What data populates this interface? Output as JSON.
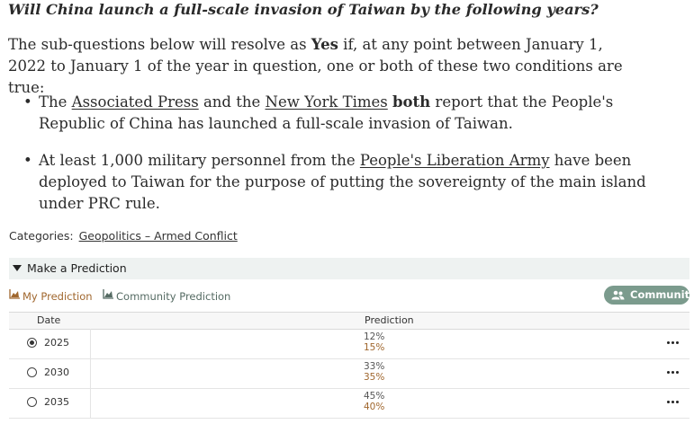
{
  "question": {
    "title": "Will China launch a full-scale invasion of Taiwan by the following years?",
    "intro_a": "The sub-questions below will resolve as ",
    "intro_yes": "Yes",
    "intro_b": " if, at any point between January 1, 2022 to January 1 of the year in question, one or both of these two conditions are true:"
  },
  "bullets": {
    "b1_pre": "The ",
    "b1_link1": "Associated Press",
    "b1_mid": " and the ",
    "b1_link2": "New York Times",
    "b1_bold": "both",
    "b1_post": " report that the People's Republic of China has launched a full-scale invasion of Taiwan.",
    "b2_pre": "At least 1,000 military personnel from the ",
    "b2_link": "People's Liberation Army",
    "b2_post": " have been deployed to Taiwan for the purpose of putting the sovereignty of the main island under PRC rule."
  },
  "categories": {
    "label": "Categories:",
    "value": "Geopolitics – Armed Conflict"
  },
  "prediction_panel": {
    "toggle_label": "Make a Prediction",
    "tab_my": "My Prediction",
    "tab_community": "Community Prediction",
    "community_button": "Community"
  },
  "table": {
    "col_date": "Date",
    "col_prediction": "Prediction",
    "rows": [
      {
        "year": "2025",
        "my": "12%",
        "community": "15%",
        "selected": true
      },
      {
        "year": "2030",
        "my": "33%",
        "community": "35%",
        "selected": false
      },
      {
        "year": "2035",
        "my": "45%",
        "community": "40%",
        "selected": false
      }
    ]
  },
  "colors": {
    "accent_brown": "#a0672e",
    "community_green": "#7b9b8d",
    "panel_bg": "#eef2f1"
  },
  "icons": {
    "tab_my": "area-chart-icon",
    "tab_community": "area-chart-icon",
    "community_button": "people-icon",
    "row_menu": "more-dots-icon",
    "toggle": "caret-down-icon"
  }
}
